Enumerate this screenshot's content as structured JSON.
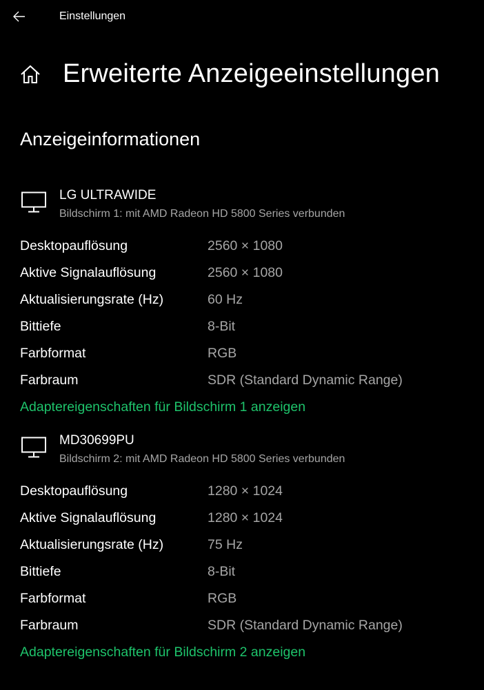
{
  "window": {
    "app_title": "Einstellungen",
    "back_icon": "arrow-left-icon"
  },
  "page": {
    "home_icon": "home-icon",
    "title": "Erweiterte Anzeigeeinstellungen",
    "section_title": "Anzeigeinformationen"
  },
  "colors": {
    "background": "#000000",
    "text": "#ffffff",
    "secondary_text": "#a6a6a6",
    "link": "#1ec36b"
  },
  "displays": [
    {
      "icon": "monitor-icon",
      "name": "LG ULTRAWIDE",
      "subtitle": "Bildschirm 1: mit AMD Radeon HD 5800 Series verbunden",
      "rows": [
        {
          "label": "Desktopauflösung",
          "value": "2560 × 1080"
        },
        {
          "label": "Aktive Signalauflösung",
          "value": "2560 × 1080"
        },
        {
          "label": "Aktualisierungsrate (Hz)",
          "value": "60 Hz"
        },
        {
          "label": "Bittiefe",
          "value": "8-Bit"
        },
        {
          "label": "Farbformat",
          "value": "RGB"
        },
        {
          "label": "Farbraum",
          "value": "SDR (Standard Dynamic Range)"
        }
      ],
      "link": "Adaptereigenschaften für Bildschirm 1 anzeigen"
    },
    {
      "icon": "monitor-icon",
      "name": "MD30699PU",
      "subtitle": "Bildschirm 2: mit AMD Radeon HD 5800 Series verbunden",
      "rows": [
        {
          "label": "Desktopauflösung",
          "value": "1280 × 1024"
        },
        {
          "label": "Aktive Signalauflösung",
          "value": "1280 × 1024"
        },
        {
          "label": "Aktualisierungsrate (Hz)",
          "value": "75 Hz"
        },
        {
          "label": "Bittiefe",
          "value": "8-Bit"
        },
        {
          "label": "Farbformat",
          "value": "RGB"
        },
        {
          "label": "Farbraum",
          "value": "SDR (Standard Dynamic Range)"
        }
      ],
      "link": "Adaptereigenschaften für Bildschirm 2 anzeigen"
    }
  ]
}
